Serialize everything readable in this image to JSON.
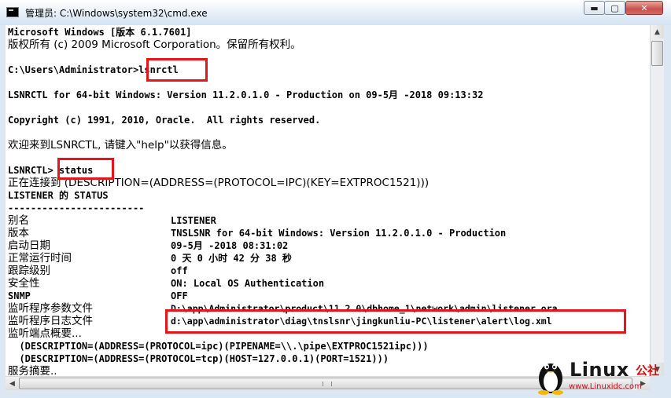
{
  "window": {
    "title": "管理员: C:\\Windows\\system32\\cmd.exe"
  },
  "controls": {
    "minimize": "▬",
    "maximize": "▢",
    "close": "✕"
  },
  "console": {
    "lines": [
      "Microsoft Windows [版本 6.1.7601]",
      "版权所有 (c) 2009 Microsoft Corporation。保留所有权利。",
      "C:\\Users\\Administrator>lsnrctl",
      "LSNRCTL for 64-bit Windows: Version 11.2.0.1.0 - Production on 09-5月 -2018 09:13:32",
      "Copyright (c) 1991, 2010, Oracle.  All rights reserved.",
      "欢迎来到LSNRCTL, 请键入\"help\"以获得信息。",
      "LSNRCTL> status",
      "正在连接到 (DESCRIPTION=(ADDRESS=(PROTOCOL=IPC)(KEY=EXTPROC1521)))",
      "LISTENER 的 STATUS",
      "------------------------",
      "别名",
      "版本",
      "启动日期",
      "正常运行时间",
      "跟踪级别",
      "安全性",
      "SNMP",
      "监听程序参数文件",
      "监听程序日志文件",
      "监听端点概要...",
      "  (DESCRIPTION=(ADDRESS=(PROTOCOL=ipc)(PIPENAME=\\\\.\\pipe\\EXTPROC1521ipc)))",
      "  (DESCRIPTION=(ADDRESS=(PROTOCOL=tcp)(HOST=127.0.0.1)(PORT=1521)))",
      "服务摘要.."
    ],
    "values": [
      "LISTENER",
      "TNSLSNR for 64-bit Windows: Version 11.2.0.1.0 - Production",
      "09-5月 -2018 08:31:02",
      "0 天 0 小时 42 分 38 秒",
      "off",
      "ON: Local OS Authentication",
      "OFF",
      "D:\\app\\Administrator\\product\\11.2.0\\dbhome_1\\network\\admin\\listener.ora",
      "d:\\app\\administrator\\diag\\tnslsnr\\jingkunliu-PC\\listener\\alert\\log.xml"
    ]
  },
  "watermark": {
    "logo": "Linux",
    "suffix": "公社",
    "url": "www.Linuxidc.com"
  },
  "colors": {
    "highlight": "#e8141b",
    "console_bg": "#ffffff",
    "console_text": "#000000"
  }
}
